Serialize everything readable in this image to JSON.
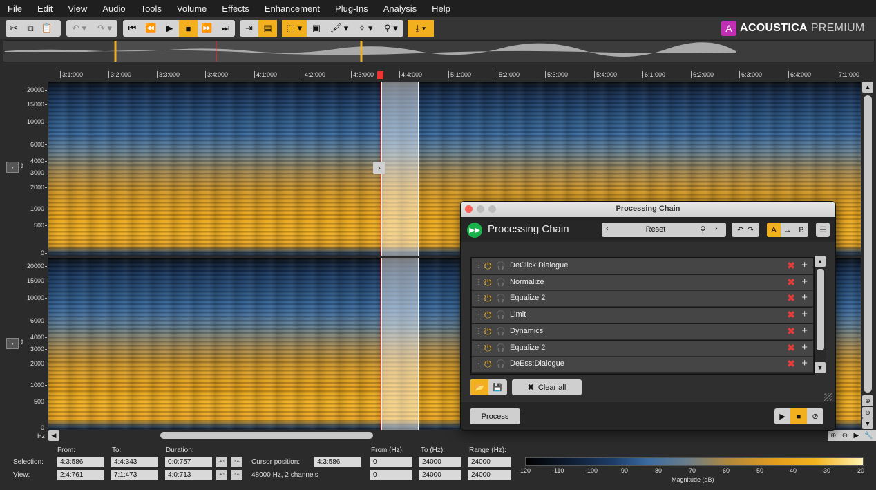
{
  "menu": [
    "File",
    "Edit",
    "View",
    "Audio",
    "Tools",
    "Volume",
    "Effects",
    "Enhancement",
    "Plug-Ins",
    "Analysis",
    "Help"
  ],
  "logo": {
    "brand": "ACOUSTICA",
    "edition": "PREMIUM"
  },
  "ruler": [
    "3:1:000",
    "3:2:000",
    "3:3:000",
    "3:4:000",
    "4:1:000",
    "4:2:000",
    "4:3:000",
    "4:4:000",
    "5:1:000",
    "5:2:000",
    "5:3:000",
    "5:4:000",
    "6:1:000",
    "6:2:000",
    "6:3:000",
    "6:4:000",
    "7:1:000"
  ],
  "freq_labels": [
    "20000",
    "15000",
    "10000",
    "6000",
    "4000",
    "3000",
    "2000",
    "1000",
    "500",
    "0"
  ],
  "hz_label": "Hz",
  "dialog": {
    "window_title": "Processing Chain",
    "header_title": "Processing Chain",
    "preset": "Reset",
    "ab": {
      "a": "A",
      "b": "B"
    },
    "items": [
      "DeClick:Dialogue",
      "Normalize",
      "Equalize 2",
      "Limit",
      "Dynamics",
      "Equalize 2",
      "DeEss:Dialogue"
    ],
    "clear_all": "Clear all",
    "process": "Process"
  },
  "status": {
    "headers": {
      "from": "From:",
      "to": "To:",
      "duration": "Duration:",
      "from_hz": "From (Hz):",
      "to_hz": "To (Hz):",
      "range_hz": "Range (Hz):"
    },
    "selection_label": "Selection:",
    "view_label": "View:",
    "selection": {
      "from": "4:3:586",
      "to": "4:4:343",
      "duration": "0:0:757",
      "from_hz": "0",
      "to_hz": "24000",
      "range_hz": "24000"
    },
    "view": {
      "from": "2:4:761",
      "to": "7:1:473",
      "duration": "4:0:713",
      "from_hz": "0",
      "to_hz": "24000",
      "range_hz": "24000"
    },
    "cursor_label": "Cursor position:",
    "cursor_value": "4:3:586",
    "format": "48000 Hz, 2 channels"
  },
  "colorbar": {
    "labels": [
      "-120",
      "-110",
      "-100",
      "-90",
      "-80",
      "-70",
      "-60",
      "-50",
      "-40",
      "-30",
      "-20"
    ],
    "title": "Magnitude (dB)"
  },
  "colors": {
    "accent": "#f2b01e",
    "play_green": "#19b24b",
    "remove_red": "#e23b3b",
    "logo": "#c12fb4"
  }
}
